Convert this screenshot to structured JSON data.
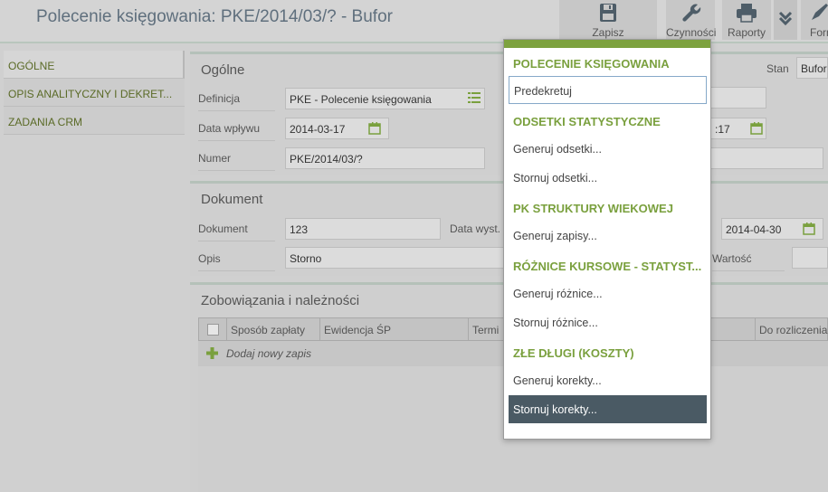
{
  "window": {
    "title": "Polecenie księgowania: PKE/2014/03/? - Bufor"
  },
  "toolbar": {
    "save_label": "Zapisz",
    "actions_label": "Czynności",
    "reports_label": "Raporty",
    "more_label": "Form",
    "save_icon": "save-icon",
    "actions_icon": "wrench-icon",
    "reports_icon": "printer-icon",
    "more_icon": "chevron-down-icon"
  },
  "left_tabs": [
    "OGÓLNE",
    "OPIS ANALITYCZNY I DEKRET...",
    "ZADANIA CRM"
  ],
  "general": {
    "title": "Ogólne",
    "definition_label": "Definicja",
    "definition_value": "PKE - Polecenie księgowania",
    "date_label": "Data wpływu",
    "date_value": "2014-03-17",
    "date2_value": ":17",
    "number_label": "Numer",
    "number_value": "PKE/2014/03/?",
    "state_label": "Stan",
    "state_value": "Bufor"
  },
  "document": {
    "title": "Dokument",
    "doc_label": "Dokument",
    "doc_value": "123",
    "issue_label": "Data wyst.",
    "issue_value": "2014-04-30",
    "desc_label": "Opis",
    "desc_value": "Storno",
    "value_label": "Wartość"
  },
  "liabilities": {
    "title": "Zobowiązania i należności",
    "columns": [
      "Sposób zapłaty",
      "Ewidencja ŚP",
      "Termi",
      "Do rozliczenia"
    ],
    "add_label": "Dodaj nowy zapis"
  },
  "menu": {
    "sections": [
      {
        "header": "POLECENIE KSIĘGOWANIA",
        "items": [
          "Predekretuj"
        ]
      },
      {
        "header": "ODSETKI STATYSTYCZNE",
        "items": [
          "Generuj odsetki...",
          "Stornuj odsetki..."
        ]
      },
      {
        "header": "PK STRUKTURY WIEKOWEJ",
        "items": [
          "Generuj zapisy..."
        ]
      },
      {
        "header": "RÓŻNICE KURSOWE - STATYST...",
        "items": [
          "Generuj różnice...",
          "Stornuj różnice..."
        ]
      },
      {
        "header": "ZŁE DŁUGI (KOSZTY)",
        "items": [
          "Generuj korekty...",
          "Stornuj korekty..."
        ]
      }
    ]
  },
  "colors": {
    "accent_green": "#7aa03e",
    "title_blue": "#5f6f7d",
    "menu_hover": "#4a5a64"
  }
}
